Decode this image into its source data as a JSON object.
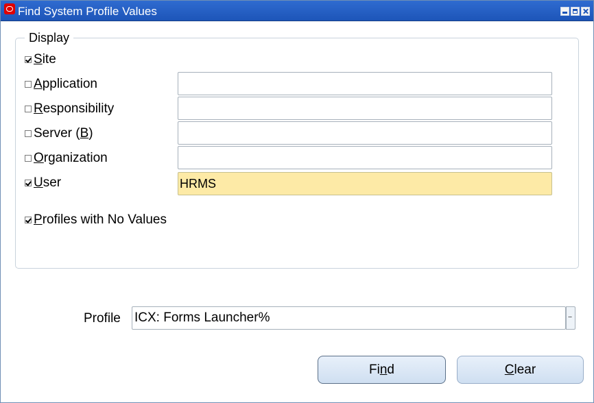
{
  "window": {
    "title": "Find System Profile Values"
  },
  "display": {
    "label": "Display",
    "rows": [
      {
        "mnemonic": "S",
        "rest": "ite",
        "checked": true
      },
      {
        "mnemonic": "A",
        "rest": "pplication",
        "checked": false,
        "value": ""
      },
      {
        "mnemonic": "R",
        "rest": "esponsibility",
        "checked": false,
        "value": ""
      },
      {
        "pre": "Server (",
        "mnemonic": "B",
        "post": ")",
        "checked": false,
        "value": ""
      },
      {
        "mnemonic": "O",
        "rest": "rganization",
        "checked": false,
        "value": ""
      },
      {
        "mnemonic": "U",
        "rest": "ser",
        "checked": true,
        "value": "HRMS"
      },
      {
        "mnemonic": "P",
        "rest": "rofiles with No Values",
        "checked": true
      }
    ]
  },
  "profile": {
    "label": "Profile",
    "value": "ICX: Forms Launcher%",
    "lov_label": "..."
  },
  "buttons": {
    "find": {
      "pre": "Fi",
      "mnemonic": "n",
      "post": "d"
    },
    "clear": {
      "mnemonic": "C",
      "post": "lear"
    }
  },
  "colors": {
    "titlebar": "#1d55b8",
    "active_field": "#fdeaa6",
    "button": "#d7e4f3"
  }
}
